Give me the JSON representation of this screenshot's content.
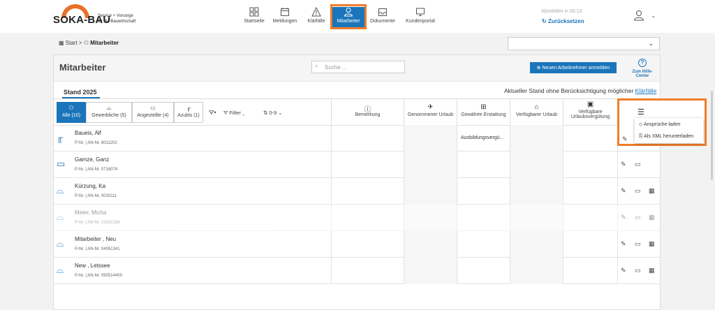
{
  "header": {
    "logo": {
      "name": "SOKA-BAU",
      "tagline1": "Service + Vorsorge",
      "tagline2": "für die Bauwirtschaft"
    },
    "nav": [
      {
        "label": "Startseite",
        "icon": "grid-icon"
      },
      {
        "label": "Meldungen",
        "icon": "calendar-icon"
      },
      {
        "label": "Klärfälle",
        "icon": "warning-icon"
      },
      {
        "label": "Mitarbeiter",
        "icon": "employees-icon",
        "active": true
      },
      {
        "label": "Dokumente",
        "icon": "inbox-icon"
      },
      {
        "label": "Kundenportal",
        "icon": "monitor-icon"
      }
    ],
    "logout_info": "Abmelden in 05:13",
    "reset_label": "Zurücksetzen"
  },
  "breadcrumb": {
    "start": "Start",
    "sep": ">",
    "current": "Mitarbeiter"
  },
  "panel": {
    "title": "Mitarbeiter",
    "search_placeholder": "Suche ...",
    "add_button": "Neuen Arbeitnehmer anmelden",
    "help_label": "Zum Hilfe-Center",
    "stand_tab": "Stand 2025",
    "stand_note": "Aktueller Stand ohne Berücksichtigung möglicher",
    "stand_link": "Klärfälle"
  },
  "filters": {
    "tabs": [
      {
        "label": "Alle (10)",
        "active": true
      },
      {
        "label": "Gewerbliche (5)"
      },
      {
        "label": "Angestellte (4)"
      },
      {
        "label": "Azubis (1)"
      }
    ],
    "filter_label": "Filter",
    "sort_label": "0-9"
  },
  "columns": [
    {
      "label": "Bemerkung"
    },
    {
      "label": "Genommener Urlaub"
    },
    {
      "label": "Gewährte Erstattung"
    },
    {
      "label": "Verfügbarer Urlaub"
    },
    {
      "label": "Verfügbare Urlaubsvergütung"
    }
  ],
  "rows": [
    {
      "name": "Baueis, Alf",
      "pnr_label": "P-Nr.",
      "annr_label": "AN-Nr.",
      "annr": "8011202",
      "type_icon": "azubi-icon",
      "erstattung": "Ausbildungsvergü..."
    },
    {
      "name": "Gamze, Ganz",
      "pnr_label": "P-Nr.",
      "annr_label": "AN-Nr.",
      "annr": "0718074",
      "type_icon": "laptop-icon"
    },
    {
      "name": "Kürzung, Ka",
      "pnr_label": "P-Nr.",
      "annr_label": "AN-Nr.",
      "annr": "0020111",
      "type_icon": "helmet-icon"
    },
    {
      "name": "Meier, Micha",
      "pnr_label": "P-Nr.",
      "annr_label": "AN-Nr.",
      "annr": "21022134",
      "type_icon": "helmet-icon",
      "muted": true
    },
    {
      "name": "Mitarbeiter , Neu",
      "pnr_label": "P-Nr.",
      "annr_label": "AN-Nr.",
      "annr": "04051341",
      "type_icon": "helmet-icon"
    },
    {
      "name": "New , Letssee",
      "pnr_label": "P-Nr.",
      "annr_label": "AN-Nr.",
      "annr": "090514400",
      "type_icon": "helmet-icon"
    }
  ],
  "context_menu": {
    "items": [
      {
        "label": "Ansprüche laden"
      },
      {
        "label": "Als XML herunterladen"
      }
    ]
  },
  "colors": {
    "primary": "#1b75bb",
    "highlight": "#f07d28",
    "logo": "#e8702a"
  }
}
